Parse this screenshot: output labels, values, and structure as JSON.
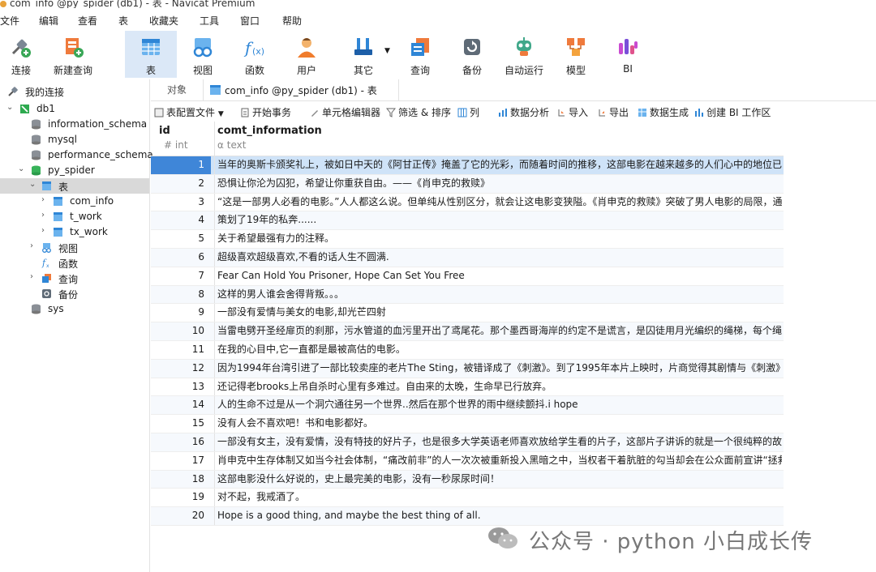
{
  "window": {
    "title": "com_info @py_spider (db1) - 表 - Navicat Premium"
  },
  "menu": [
    "文件",
    "编辑",
    "查看",
    "表",
    "收藏夹",
    "工具",
    "窗口",
    "帮助"
  ],
  "toolbar": [
    {
      "label": "连接",
      "icon": "connection-icon"
    },
    {
      "label": "新建查询",
      "icon": "new-query-icon"
    },
    {
      "label": "表",
      "icon": "table-icon",
      "active": true
    },
    {
      "label": "视图",
      "icon": "view-icon"
    },
    {
      "label": "函数",
      "icon": "function-icon"
    },
    {
      "label": "用户",
      "icon": "user-icon"
    },
    {
      "label": "其它",
      "icon": "tools-icon"
    },
    {
      "label": "查询",
      "icon": "query-icon"
    },
    {
      "label": "备份",
      "icon": "backup-icon"
    },
    {
      "label": "自动运行",
      "icon": "robot-icon"
    },
    {
      "label": "模型",
      "icon": "model-icon"
    },
    {
      "label": "BI",
      "icon": "bi-icon"
    }
  ],
  "sidebar": {
    "header": "我的连接",
    "connection": "db1",
    "databases": [
      "information_schema",
      "mysql",
      "performance_schema",
      "py_spider",
      "sys"
    ],
    "py_spider": {
      "tables_label": "表",
      "tables": [
        "com_info",
        "t_work",
        "tx_work"
      ],
      "views_label": "视图",
      "functions_label": "函数",
      "queries_label": "查询",
      "backups_label": "备份"
    }
  },
  "tabs": {
    "objects": "对象",
    "current": "com_info @py_spider (db1) - 表"
  },
  "subtoolbar": {
    "table_config": "表配置文件",
    "begin_transaction": "开始事务",
    "cell_editor": "单元格编辑器",
    "filter_sort": "筛选 & 排序",
    "columns": "列",
    "data_analysis": "数据分析",
    "import": "导入",
    "export": "导出",
    "data_generation": "数据生成",
    "create_bi": "创建 BI 工作区"
  },
  "grid": {
    "columns": [
      {
        "name": "id",
        "type": "int"
      },
      {
        "name": "comt_information",
        "type": "text"
      }
    ],
    "rows": [
      {
        "id": "1",
        "text": "当年的奥斯卡颁奖礼上，被如日中天的《阿甘正传》掩盖了它的光彩，而随着时间的推移，这部电影在越来越多的人们心中的地位已超越了"
      },
      {
        "id": "2",
        "text": "恐惧让你沦为囚犯，希望让你重获自由。——《肖申克的救赎》"
      },
      {
        "id": "3",
        "text": "“这是一部男人必看的电影。”人人都这么说。但单纯从性别区分，就会让这电影变狭隘。《肖申克的救赎》突破了男人电影的局限，通篇几乎"
      },
      {
        "id": "4",
        "text": "策划了19年的私奔......"
      },
      {
        "id": "5",
        "text": "关于希望最强有力的注释。"
      },
      {
        "id": "6",
        "text": "超级喜欢超级喜欢,不看的话人生不圆满."
      },
      {
        "id": "7",
        "text": "Fear Can Hold You Prisoner, Hope Can Set You Free"
      },
      {
        "id": "8",
        "text": "这样的男人谁会舍得背叛。。。"
      },
      {
        "id": "9",
        "text": "一部没有爱情与美女的电影,却光芒四射"
      },
      {
        "id": "10",
        "text": "当雷电劈开圣经扉页的刹那，污水管道的血污里开出了鸢尾花。那个墨西哥海岸的约定不是谎言，是囚徒用月光编织的绳梯，每个绳结都系"
      },
      {
        "id": "11",
        "text": "在我的心目中,它一直都是最被高估的电影。"
      },
      {
        "id": "12",
        "text": "因为1994年台湾引进了一部比较卖座的老片The Sting，被错译成了《刺激》。到了1995年本片上映时，片商觉得其剧情与《刺激》有类似"
      },
      {
        "id": "13",
        "text": "还记得老brooks上吊自杀时心里有多难过。自由来的太晚，生命早已行放弃。"
      },
      {
        "id": "14",
        "text": "人的生命不过是从一个洞穴通往另一个世界..然后在那个世界的雨中继续颤抖.i hope"
      },
      {
        "id": "15",
        "text": "没有人会不喜欢吧！书和电影都好。"
      },
      {
        "id": "16",
        "text": "一部没有女主，没有爱情，没有特技的好片子，也是很多大学英语老师喜欢放给学生看的片子，这部片子讲诉的就是一个很纯粹的故事，一"
      },
      {
        "id": "17",
        "text": "肖申克中生存体制又如当今社会体制，“痛改前非”的人一次次被重新投入黑暗之中，当权者干着肮脏的勾当却会在公众面前宣讲“拯救之道”，"
      },
      {
        "id": "18",
        "text": "这部电影没什么好说的，史上最完美的电影，没有一秒尿尿时间！"
      },
      {
        "id": "19",
        "text": "对不起，我戒酒了。"
      },
      {
        "id": "20",
        "text": "Hope is a good thing, and maybe the best thing of all."
      }
    ],
    "selected_row": "1"
  },
  "watermark": {
    "text": "公众号 · python 小白成长传"
  },
  "colors": {
    "accent": "#3f86d8",
    "selected_row": "#cfe3f8",
    "active_tool": "#dbe8f7"
  }
}
